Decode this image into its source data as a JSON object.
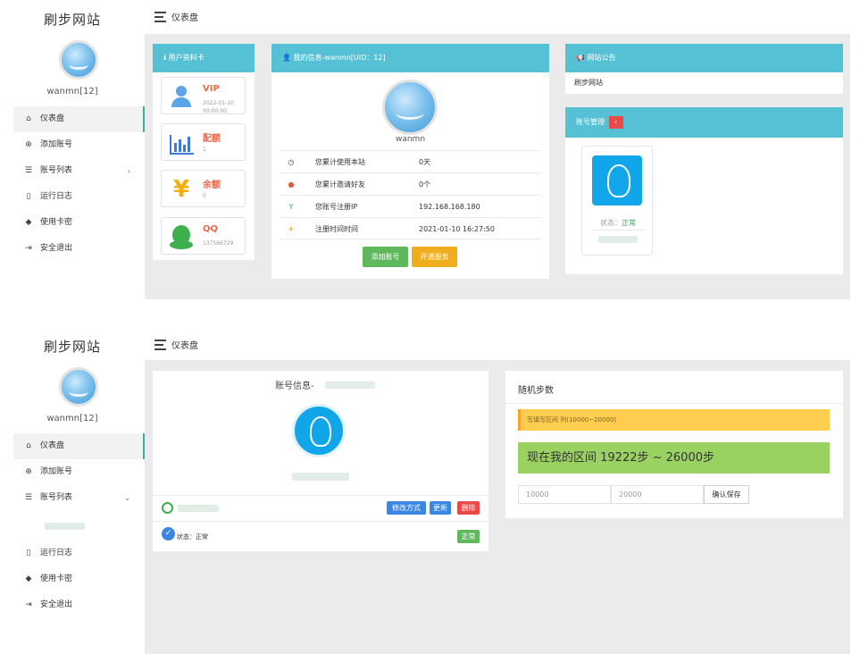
{
  "shot1": {
    "sidebar": {
      "brand": "刷步网站",
      "username": "wanmn[12]",
      "nav": [
        {
          "label": "仪表盘",
          "icon": "home-icon"
        },
        {
          "label": "添加账号",
          "icon": "plus-circle-icon"
        },
        {
          "label": "账号列表",
          "icon": "list-icon",
          "arrow": "›"
        },
        {
          "label": "运行日志",
          "icon": "file-icon"
        },
        {
          "label": "使用卡密",
          "icon": "tag-icon"
        },
        {
          "label": "安全退出",
          "icon": "exit-icon"
        }
      ]
    },
    "topbar": {
      "title": "仪表盘"
    },
    "profile_card": {
      "header": "用户资料卡",
      "items": [
        {
          "title": "VIP",
          "value": "2022-01-10 00:00:00",
          "icon": "user-icon"
        },
        {
          "title": "配额",
          "value": "1",
          "icon": "bar-chart-icon"
        },
        {
          "title": "余额",
          "value": "0",
          "icon": "yen-icon"
        },
        {
          "title": "QQ",
          "value": "137566729",
          "icon": "qq-icon"
        }
      ]
    },
    "my_info": {
      "header": "我的信息-wanmn[UID：12]",
      "name": "wanmn",
      "rows": [
        {
          "label": "您累计使用本站",
          "value": "0天",
          "icon": "clock-icon"
        },
        {
          "label": "您累计邀请好友",
          "value": "0个",
          "icon": "user-small-icon"
        },
        {
          "label": "您账号注册IP",
          "value": "192.168.168.180",
          "icon": "glass-icon"
        },
        {
          "label": "注册时间时间",
          "value": "2021-01-10 16:27:50",
          "icon": "plane-icon"
        }
      ],
      "add_button": "添加账号",
      "open_button": "开通服务"
    },
    "notice": {
      "header": "网站公告",
      "text": "刷步网站"
    },
    "account_mgmt": {
      "header": "账号管理",
      "badge": "‹",
      "status_label": "状态：",
      "status_value": "正常"
    }
  },
  "shot2": {
    "sidebar": {
      "brand": "刷步网站",
      "username": "wanmn[12]",
      "nav": [
        {
          "label": "仪表盘",
          "icon": "home-icon"
        },
        {
          "label": "添加账号",
          "icon": "plus-circle-icon"
        },
        {
          "label": "账号列表",
          "icon": "list-icon",
          "arrow": "⌄"
        },
        {
          "label": "运行日志",
          "icon": "file-icon"
        },
        {
          "label": "使用卡密",
          "icon": "tag-icon"
        },
        {
          "label": "安全退出",
          "icon": "exit-icon"
        }
      ]
    },
    "topbar": {
      "title": "仪表盘"
    },
    "account_info": {
      "title": "账号信息-",
      "modify_button": "修改方式",
      "update_button": "更新",
      "delete_button": "删除",
      "status_text": "状态：正常",
      "status_badge": "正常"
    },
    "random_steps": {
      "title": "随机步数",
      "hint": "写填写区间 列(10000~20000)",
      "range_text": "现在我的区间 19222步 ~ 26000步",
      "min_placeholder": "10000",
      "max_placeholder": "20000",
      "save_button": "确认保存"
    }
  },
  "colors": {
    "header_teal": "#56c1d4",
    "accent_green": "#5fb85c",
    "accent_yellow": "#f0ad1e",
    "qq_blue": "#11a6ea",
    "warning_bar": "#ffcd4f",
    "success_bar": "#9ad262"
  }
}
